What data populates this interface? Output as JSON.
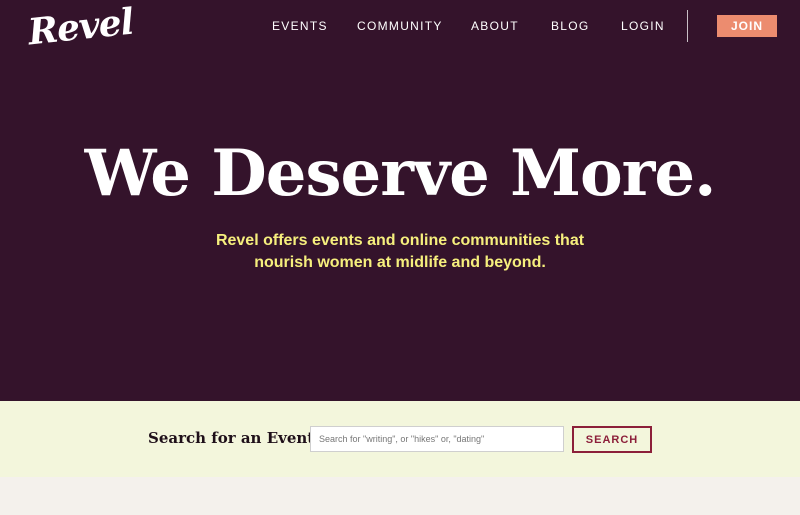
{
  "header": {
    "logo_text": "Revel",
    "nav": [
      "EVENTS",
      "COMMUNITY",
      "ABOUT",
      "BLOG",
      "LOGIN"
    ],
    "join_label": "JOIN"
  },
  "hero": {
    "headline": "We Deserve More.",
    "subtext_line1": "Revel offers events and online communities that",
    "subtext_line2": "nourish women at midlife and beyond."
  },
  "search": {
    "title": "Search for an Event",
    "placeholder": "Search for \"writing\", or \"hikes\" or, \"dating\"",
    "button_label": "SEARCH"
  },
  "colors": {
    "hero_background": "#34132b",
    "subtext": "#f6ef7d",
    "join_button": "#ec8c6f",
    "search_band": "#f3f6dc",
    "search_button": "#8c1f3a"
  }
}
